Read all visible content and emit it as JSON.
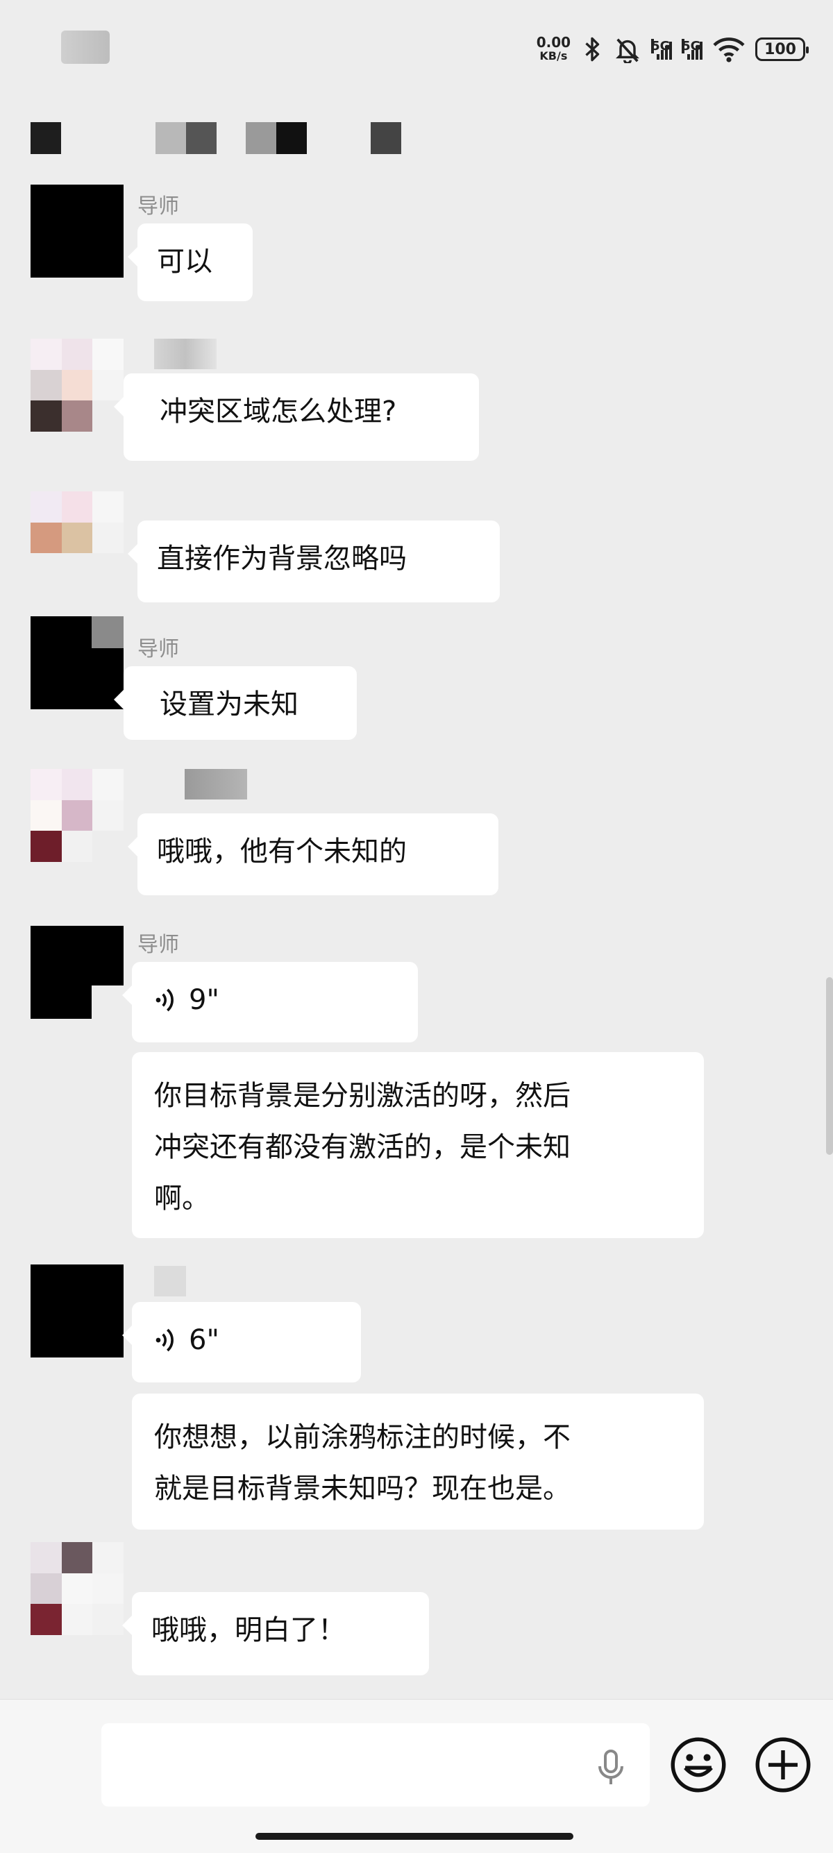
{
  "status_bar": {
    "net_speed_value": "0.00",
    "net_speed_unit": "KB/s",
    "sim1_label": "5G",
    "sim2_label": "5G",
    "battery": "100"
  },
  "messages": [
    {
      "sender": "导师",
      "text": "可以"
    },
    {
      "sender": "",
      "text": "冲突区域怎么处理?"
    },
    {
      "sender": "",
      "text": "直接作为背景忽略吗"
    },
    {
      "sender": "导师",
      "text": "设置为未知"
    },
    {
      "sender": "",
      "text": "哦哦，他有个未知的"
    },
    {
      "sender": "导师",
      "voice_duration": "9\"",
      "lines": [
        "你目标背景是分别激活的呀，然后",
        "冲突还有都没有激活的，是个未知",
        "啊。"
      ]
    },
    {
      "sender": "",
      "voice_duration": "6\"",
      "lines": [
        "你想想，以前涂鸦标注的时候，不",
        "就是目标背景未知吗？现在也是。"
      ]
    },
    {
      "sender": "",
      "text": "哦哦，明白了！"
    }
  ],
  "input_bar": {
    "text_value": "",
    "icons": [
      "microphone-icon",
      "emoji-icon",
      "plus-icon"
    ]
  },
  "colors": {
    "background": "#ededed",
    "bubble": "#ffffff",
    "sender_name": "#8d8d8d"
  }
}
